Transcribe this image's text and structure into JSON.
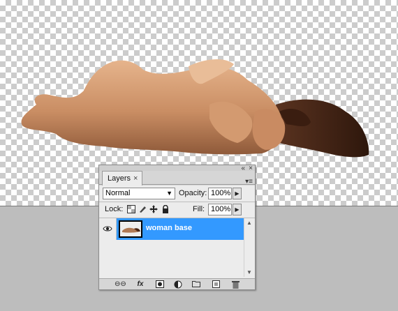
{
  "canvas": {
    "layer_content": "woman-figure-cutout"
  },
  "layers_panel": {
    "tab_label": "Layers",
    "close_glyph": "×",
    "collapse_glyph": "«",
    "panel_close_glyph": "×",
    "menu_glyph": "▾≡",
    "blend_mode": "Normal",
    "opacity_label": "Opacity:",
    "opacity_value": "100%",
    "lock_label": "Lock:",
    "fill_label": "Fill:",
    "fill_value": "100%",
    "layers": [
      {
        "name": "woman base",
        "visible": true,
        "selected": true
      }
    ],
    "footer_icons": [
      "link-layers-icon",
      "fx-icon",
      "mask-icon",
      "adjustment-layer-icon",
      "new-group-icon",
      "new-layer-icon",
      "trash-icon"
    ],
    "fx_label": "fx"
  },
  "colors": {
    "selection": "#3399ff",
    "workspace": "#bdbdbd",
    "panel": "#ececec"
  }
}
